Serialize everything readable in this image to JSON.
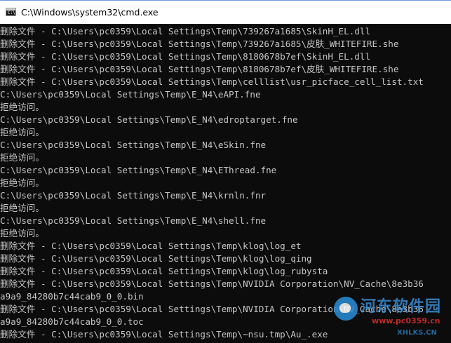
{
  "window": {
    "title": "C:\\Windows\\system32\\cmd.exe",
    "icon": "cmd-console-icon",
    "icon_text": "C:\\"
  },
  "colors": {
    "titlebar_bg": "#ffffff",
    "console_bg": "#0c0c0c",
    "console_fg": "#c6c6c6",
    "watermark_blue": "#3a94e0",
    "watermark_red": "#e03030"
  },
  "console": {
    "lines": [
      "删除文件 - C:\\Users\\pc0359\\Local Settings\\Temp\\739267a1685\\SkinH_EL.dll",
      "删除文件 - C:\\Users\\pc0359\\Local Settings\\Temp\\739267a1685\\皮肤_WHITEFIRE.she",
      "删除文件 - C:\\Users\\pc0359\\Local Settings\\Temp\\8180678b7ef\\SkinH_EL.dll",
      "删除文件 - C:\\Users\\pc0359\\Local Settings\\Temp\\8180678b7ef\\皮肤_WHITEFIRE.she",
      "删除文件 - C:\\Users\\pc0359\\Local Settings\\Temp\\celllist\\usr_picface_cell_list.txt",
      "C:\\Users\\pc0359\\Local Settings\\Temp\\E_N4\\eAPI.fne",
      "拒绝访问。",
      "C:\\Users\\pc0359\\Local Settings\\Temp\\E_N4\\edroptarget.fne",
      "拒绝访问。",
      "C:\\Users\\pc0359\\Local Settings\\Temp\\E_N4\\eSkin.fne",
      "拒绝访问。",
      "C:\\Users\\pc0359\\Local Settings\\Temp\\E_N4\\EThread.fne",
      "拒绝访问。",
      "C:\\Users\\pc0359\\Local Settings\\Temp\\E_N4\\krnln.fnr",
      "拒绝访问。",
      "C:\\Users\\pc0359\\Local Settings\\Temp\\E_N4\\shell.fne",
      "拒绝访问。",
      "删除文件 - C:\\Users\\pc0359\\Local Settings\\Temp\\klog\\log_et",
      "删除文件 - C:\\Users\\pc0359\\Local Settings\\Temp\\klog\\log_qing",
      "删除文件 - C:\\Users\\pc0359\\Local Settings\\Temp\\klog\\log_rubysta",
      "删除文件 - C:\\Users\\pc0359\\Local Settings\\Temp\\NVIDIA Corporation\\NV_Cache\\8e3b36",
      "a9a9_84280b7c44cab9_0_0.bin",
      "删除文件 - C:\\Users\\pc0359\\Local Settings\\Temp\\NVIDIA Corporation\\NV_Cache\\8e3b36",
      "a9a9_84280b7c44cab9_0_0.toc",
      "删除文件 - C:\\Users\\pc0359\\Local Settings\\Temp\\~nsu.tmp\\Au_.exe"
    ]
  },
  "watermark": {
    "logo_icon": "river-east-logo-icon",
    "text": "河东软件园",
    "url": "www.pc0359.cn",
    "sub": "XHLKS.CN"
  }
}
